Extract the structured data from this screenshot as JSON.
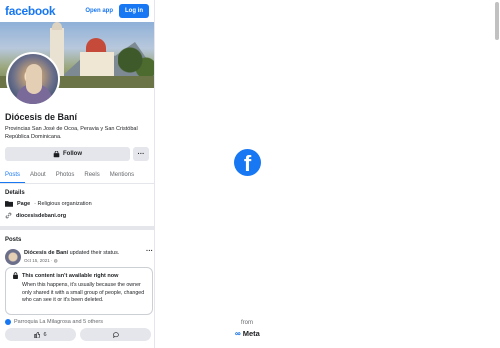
{
  "topbar": {
    "logo": "facebook",
    "open_app": "Open app",
    "login": "Log in"
  },
  "page": {
    "name": "Diócesis de Baní",
    "description": "Provincias San José de Ocoa, Peravia y San Cristóbal República Dominicana.",
    "follow": "Follow",
    "more": "···"
  },
  "tabs": [
    "Posts",
    "About",
    "Photos",
    "Reels",
    "Mentions"
  ],
  "details": {
    "heading": "Details",
    "page_label": "Page",
    "page_type": "· Religious organization",
    "link": "diocesisdebani.org"
  },
  "posts": {
    "heading": "Posts",
    "author": "Diócesis de Baní",
    "action": "updated their status.",
    "time": "Oct 15, 2021 · ",
    "more": "···",
    "notice_title": "This content isn't available right now",
    "notice_body": "When this happens, it's usually because the owner only shared it with a small group of people, changed who can see it or it's been deleted.",
    "reactions": "Parroquia La Milagrosa and 5 others",
    "likes": "6"
  },
  "footer": {
    "from": "from",
    "meta": "Meta",
    "meta_symbol": "∞"
  },
  "colors": {
    "brand": "#1877f2"
  }
}
